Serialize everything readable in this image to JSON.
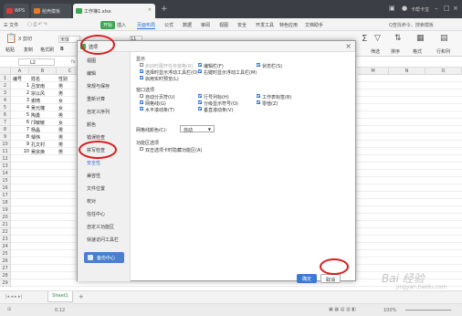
{
  "titlebar": {
    "tabs": [
      {
        "label": "WPS",
        "icon": "wps-logo-icon"
      },
      {
        "label": "稻壳模板",
        "icon": "docer-logo-icon"
      },
      {
        "label": "工作簿1.xlsx",
        "icon": "spreadsheet-doc-icon"
      }
    ],
    "user": "卡帮卡宝"
  },
  "menubar": {
    "file": "☰ 文件",
    "start": "开始",
    "items": [
      "插入",
      "页面布局",
      "公式",
      "数据",
      "审阅",
      "视图",
      "安全",
      "开发工具",
      "特色应用",
      "文档助手"
    ],
    "search": "Q查找命令、搜索模板"
  },
  "ribbon": {
    "cut": "X 剪切",
    "paste": "粘贴",
    "copy": "复制",
    "format_painter": "格式刷",
    "font": "宋体",
    "bold": "B",
    "font_size": "11",
    "filter": "筛选",
    "sort": "排序",
    "format": "格式",
    "rows_cols": "行和列"
  },
  "formula_bar": {
    "namebox": "L2",
    "fx": "fx"
  },
  "spreadsheet": {
    "col_headers": [
      "A",
      "B",
      "C",
      "D",
      "E",
      "F",
      "G",
      "H",
      "I",
      "J",
      "K",
      "L",
      "M",
      "N",
      "O"
    ],
    "row_headers": [
      "1",
      "2",
      "3",
      "4",
      "5",
      "6",
      "7",
      "8",
      "9",
      "10",
      "11",
      "12",
      "13",
      "14",
      "15",
      "16",
      "17",
      "18",
      "19",
      "20",
      "21",
      "22",
      "23",
      "24",
      "25",
      "26",
      "27",
      "28",
      "29"
    ],
    "rows": [
      [
        "编号",
        "姓名",
        "性别"
      ],
      [
        "1",
        "吕安南",
        "男"
      ],
      [
        "2",
        "宗以风",
        "男"
      ],
      [
        "3",
        "谢琦",
        "女"
      ],
      [
        "4",
        "吴元槐",
        "女"
      ],
      [
        "5",
        "陶勇",
        "男"
      ],
      [
        "6",
        "邝敏敏",
        "女"
      ],
      [
        "7",
        "杨晶",
        "男"
      ],
      [
        "8",
        "邹伟",
        "男"
      ],
      [
        "9",
        "孔文村",
        "男"
      ],
      [
        "10",
        "吴宗焕",
        "男"
      ]
    ]
  },
  "sheetbar": {
    "sheet": "Sheet1",
    "add": "+"
  },
  "statusbar": {
    "value": "0.12",
    "zoom": "100%"
  },
  "dialog": {
    "title": "选项",
    "close": "×",
    "sidebar": [
      "视图",
      "编辑",
      "常规与保存",
      "重新计算",
      "自定义序列",
      "颜色",
      "错误检查",
      "拼写检查",
      "安全性",
      "兼容性",
      "文件位置",
      "校对",
      "信任中心",
      "自定义功能区",
      "快速访问工具栏"
    ],
    "vip_label": "备份中心",
    "display_title": "显示",
    "display_opts": [
      {
        "label": "启动时展开任务窗格(R)",
        "checked": false,
        "disabled": true
      },
      {
        "label": "编辑栏(F)",
        "checked": true
      },
      {
        "label": "状态栏(S)",
        "checked": true
      },
      {
        "label": "选择时显示浮动工具栏(O)",
        "checked": true
      },
      {
        "label": "右键时显示浮动工具栏(M)",
        "checked": true
      },
      {
        "label": "启用实时预览(L)",
        "checked": true
      }
    ],
    "window_title": "窗口选项",
    "window_opts": [
      {
        "label": "自动分页符(U)",
        "checked": false
      },
      {
        "label": "行号列标(H)",
        "checked": true
      },
      {
        "label": "工作表标签(B)",
        "checked": true
      },
      {
        "label": "网格线(G)",
        "checked": true
      },
      {
        "label": "分级显示符号(O)",
        "checked": true
      },
      {
        "label": "零值(Z)",
        "checked": true
      },
      {
        "label": "水平滚动条(T)",
        "checked": true
      },
      {
        "label": "垂直滚动条(V)",
        "checked": true
      }
    ],
    "grid_color_label": "网格线颜色(C):",
    "grid_color_value": "自动",
    "func_title": "功能区选项",
    "func_opts": [
      {
        "label": "双击选项卡时隐藏功能区(A)",
        "checked": false
      }
    ],
    "ok": "确定",
    "cancel": "取消"
  },
  "watermark": {
    "line1": "Bai 经验",
    "line2": "jingyan.baidu.com"
  },
  "colors": {
    "accent": "#2a6fd6",
    "annotation": "#d61f1f",
    "titlebar": "#3b3f45",
    "start_button": "#3ea552"
  }
}
